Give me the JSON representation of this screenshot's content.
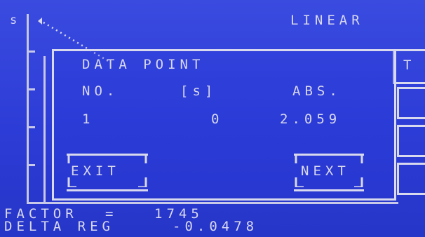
{
  "header": {
    "axis_unit": "s",
    "mode": "LINEAR"
  },
  "dialog": {
    "title": "DATA POINT",
    "columns": [
      "NO.",
      "[s]",
      "ABS."
    ],
    "row": {
      "no": "1",
      "time": "0",
      "abs": "2.059"
    },
    "exit_label": "EXIT",
    "next_label": "NEXT"
  },
  "side_tab": {
    "label": "T"
  },
  "footer": {
    "factor_label": "FACTOR",
    "factor_sep": "=",
    "factor_value": "1745",
    "delta_label": "DELTA REG",
    "delta_value": "-0.0478"
  },
  "colors": {
    "background": "#2a3ad0",
    "foreground": "#d8d8ee"
  }
}
